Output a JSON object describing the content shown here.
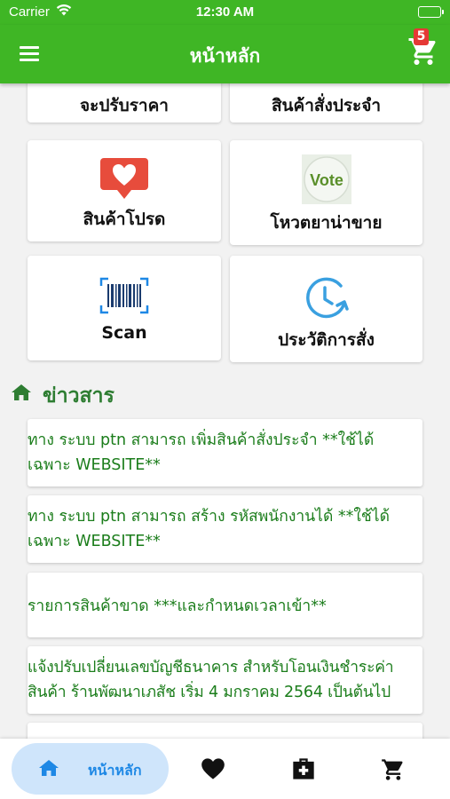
{
  "status_bar": {
    "carrier": "Carrier",
    "time": "12:30 AM"
  },
  "app_bar": {
    "title": "หน้าหลัก",
    "cart_badge": "5"
  },
  "tiles": [
    {
      "label": "จะปรับราคา",
      "icon": "price-icon"
    },
    {
      "label": "สินค้าสั่งประจำ",
      "icon": "regular-order-icon"
    },
    {
      "label": "สินค้าโปรด",
      "icon": "heart-icon"
    },
    {
      "label": "โหวตยาน่าขาย",
      "icon": "vote-icon",
      "icon_text": "Vote"
    },
    {
      "label": "Scan",
      "icon": "barcode-scan-icon"
    },
    {
      "label": "ประวัติการสั่ง",
      "icon": "history-clock-icon"
    }
  ],
  "news": {
    "title": "ข่าวสาร",
    "items": [
      "ทาง ระบบ ptn สามารถ เพิ่มสินค้าสั่งประจำ **ใช้ได้ เฉพาะ WEBSITE**",
      "ทาง ระบบ ptn สามารถ สร้าง รหัสพนักงานได้ **ใช้ได้ เฉพาะ WEBSITE**",
      "รายการสินค้าขาด ***และกำหนดเวลาเข้า**",
      "แจ้งปรับเปลี่ยนเลขบัญชีธนาคาร สำหรับโอนเงินชำระค่า สินค้า ร้านพัฒนาเภสัช เริ่ม 4 มกราคม 2564 เป็นต้นไป"
    ]
  },
  "bottom_nav": {
    "home_label": "หน้าหลัก",
    "items": [
      "home-icon",
      "heart-icon",
      "medical-kit-icon",
      "cart-icon"
    ]
  },
  "colors": {
    "primary_green": "#3fb625",
    "news_text_green": "#1b7d1b",
    "active_nav_bg": "#cfe5fb",
    "active_nav_fg": "#1e88e5",
    "heart_red": "#e74c3c",
    "badge_red": "#e53935"
  }
}
